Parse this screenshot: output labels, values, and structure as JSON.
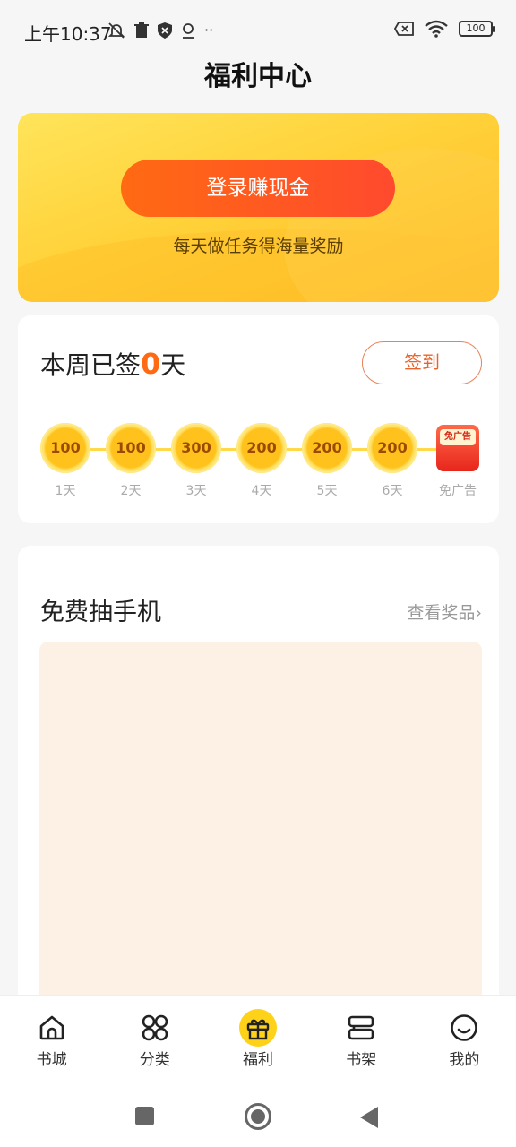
{
  "status_bar": {
    "time": "上午10:37",
    "left_icons": [
      "bell-off-icon",
      "trash-icon",
      "shield-icon",
      "location-icon",
      "more-icon"
    ],
    "more_text": "··",
    "battery": "100"
  },
  "title": "福利中心",
  "banner": {
    "button_label": "登录赚现金",
    "subtitle": "每天做任务得海量奖励"
  },
  "sign_in": {
    "prefix": "本周已签",
    "count": "0",
    "suffix": "天",
    "button_label": "签到",
    "days": [
      {
        "value": "100",
        "label": "1天"
      },
      {
        "value": "100",
        "label": "2天"
      },
      {
        "value": "300",
        "label": "3天"
      },
      {
        "value": "200",
        "label": "4天"
      },
      {
        "value": "200",
        "label": "5天"
      },
      {
        "value": "200",
        "label": "6天"
      }
    ],
    "final_day": {
      "badge": "免广告",
      "label": "免广告"
    }
  },
  "lottery": {
    "title": "免费抽手机",
    "link_label": "查看奖品",
    "link_chevron": "›"
  },
  "tab_bar": {
    "items": [
      {
        "label": "书城",
        "icon": "home-icon"
      },
      {
        "label": "分类",
        "icon": "category-icon"
      },
      {
        "label": "福利",
        "icon": "gift-icon",
        "active": true
      },
      {
        "label": "书架",
        "icon": "bookshelf-icon"
      },
      {
        "label": "我的",
        "icon": "smile-icon"
      }
    ]
  },
  "colors": {
    "accent_orange": "#ff6a12",
    "banner_yellow": "#ffd23a",
    "active_tab": "#ffd21a"
  }
}
